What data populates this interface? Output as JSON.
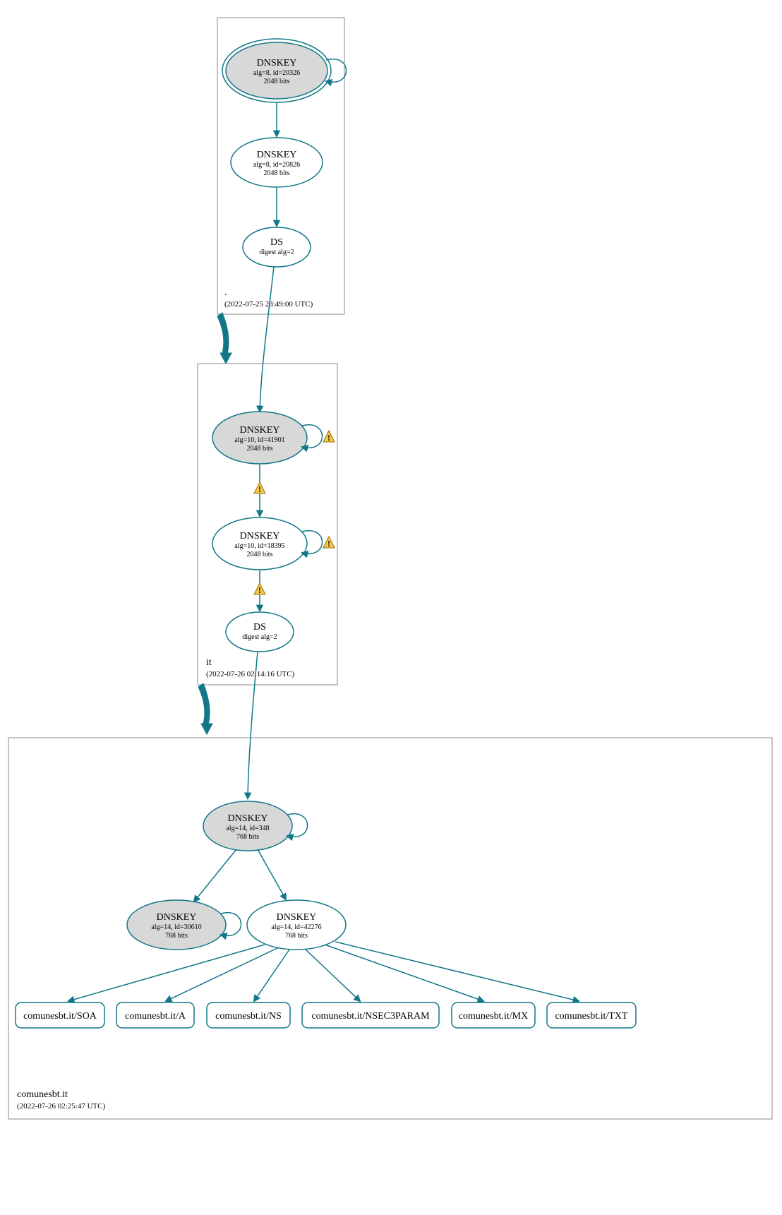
{
  "colors": {
    "stroke": "#117788",
    "ksk_fill": "#d8d8d8",
    "warn_fill": "#f2c94c"
  },
  "zones": {
    "root": {
      "name": ".",
      "timestamp": "(2022-07-25 23:49:00 UTC)"
    },
    "it": {
      "name": "it",
      "timestamp": "(2022-07-26 02:14:16 UTC)"
    },
    "domain": {
      "name": "comunesbt.it",
      "timestamp": "(2022-07-26 02:25:47 UTC)"
    }
  },
  "nodes": {
    "root_ksk": {
      "title": "DNSKEY",
      "alg": "alg=8, id=20326",
      "bits": "2048 bits"
    },
    "root_zsk": {
      "title": "DNSKEY",
      "alg": "alg=8, id=20826",
      "bits": "2048 bits"
    },
    "root_ds": {
      "title": "DS",
      "alg": "digest alg=2"
    },
    "it_ksk": {
      "title": "DNSKEY",
      "alg": "alg=10, id=41901",
      "bits": "2048 bits"
    },
    "it_zsk": {
      "title": "DNSKEY",
      "alg": "alg=10, id=18395",
      "bits": "2048 bits"
    },
    "it_ds": {
      "title": "DS",
      "alg": "digest alg=2"
    },
    "dom_ksk": {
      "title": "DNSKEY",
      "alg": "alg=14, id=348",
      "bits": "768 bits"
    },
    "dom_zsk1": {
      "title": "DNSKEY",
      "alg": "alg=14, id=30610",
      "bits": "768 bits"
    },
    "dom_zsk2": {
      "title": "DNSKEY",
      "alg": "alg=14, id=42276",
      "bits": "768 bits"
    }
  },
  "records": {
    "soa": "comunesbt.it/SOA",
    "a": "comunesbt.it/A",
    "ns": "comunesbt.it/NS",
    "nsec3p": "comunesbt.it/NSEC3PARAM",
    "mx": "comunesbt.it/MX",
    "txt": "comunesbt.it/TXT"
  }
}
